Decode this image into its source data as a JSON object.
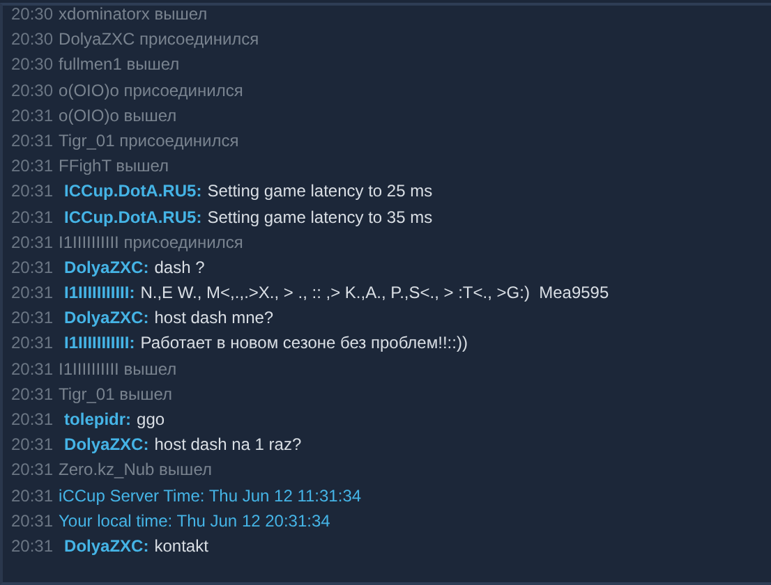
{
  "chat_log": [
    {
      "kind": "event",
      "time": "20:30",
      "text": "xdominatorx вышел"
    },
    {
      "kind": "event",
      "time": "20:30",
      "text": "DolyaZXC присоединился"
    },
    {
      "kind": "event",
      "time": "20:30",
      "text": "fullmen1 вышел"
    },
    {
      "kind": "event",
      "time": "20:30",
      "text": "o(OIO)o присоединился"
    },
    {
      "kind": "event",
      "time": "20:31",
      "text": "o(OIO)o вышел"
    },
    {
      "kind": "event",
      "time": "20:31",
      "text": "Tigr_01 присоединился"
    },
    {
      "kind": "event",
      "time": "20:31",
      "text": "FFighT вышел"
    },
    {
      "kind": "chat",
      "time": "20:31",
      "sender": "ICCup.DotA.RU5:",
      "text": "Setting game latency to 25 ms"
    },
    {
      "kind": "chat",
      "time": "20:31",
      "sender": "ICCup.DotA.RU5:",
      "text": "Setting game latency to 35 ms"
    },
    {
      "kind": "event",
      "time": "20:31",
      "text": "I1IIIIIIIIII присоединился"
    },
    {
      "kind": "chat",
      "time": "20:31",
      "sender": "DolyaZXC:",
      "text": "dash ?"
    },
    {
      "kind": "chat",
      "time": "20:31",
      "sender": "I1IIIIIIIIIII:",
      "text": "N.,E W., M<,.,.>X., > ., :: ,> K.,A., P.,S<., > :T<., >G:)  Mea9595"
    },
    {
      "kind": "chat",
      "time": "20:31",
      "sender": "DolyaZXC:",
      "text": "host dash mne?"
    },
    {
      "kind": "chat",
      "time": "20:31",
      "sender": "I1IIIIIIIIIII:",
      "text": "Работает в новом сезоне без проблем!!::))"
    },
    {
      "kind": "event",
      "time": "20:31",
      "text": "I1IIIIIIIIII вышел"
    },
    {
      "kind": "event",
      "time": "20:31",
      "text": "Tigr_01 вышел"
    },
    {
      "kind": "chat",
      "time": "20:31",
      "sender": "tolepidr:",
      "text": "ggo"
    },
    {
      "kind": "chat",
      "time": "20:31",
      "sender": "DolyaZXC:",
      "text": "host dash na 1 raz?"
    },
    {
      "kind": "event",
      "time": "20:31",
      "text": "Zero.kz_Nub вышел"
    },
    {
      "kind": "system",
      "time": "20:31",
      "text": "iCCup Server Time: Thu Jun 12 11:31:34"
    },
    {
      "kind": "system",
      "time": "20:31",
      "text": "Your local time: Thu Jun 12 20:31:34"
    },
    {
      "kind": "chat",
      "time": "20:31",
      "sender": "DolyaZXC:",
      "text": "kontakt"
    }
  ]
}
